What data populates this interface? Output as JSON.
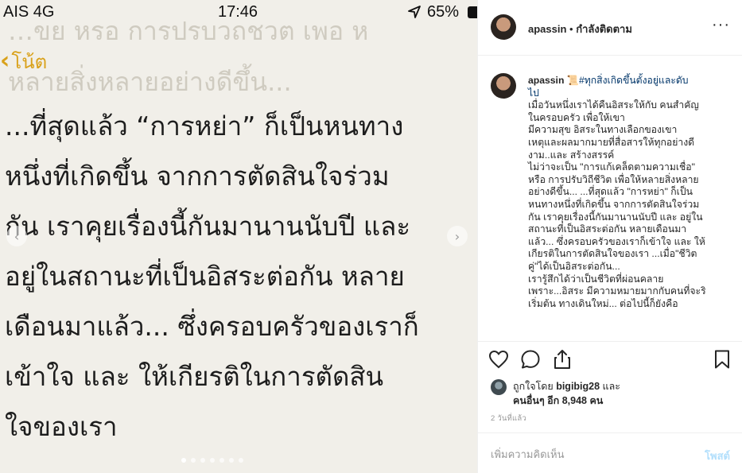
{
  "photo": {
    "status_bar": {
      "carrier": "AIS 4G",
      "time": "17:46",
      "battery": "65%"
    },
    "ghost_top": "…ขย  หรอ การปรบวถชวต เพอ ห",
    "back_label": "โน้ต",
    "ghost_mid": "หลายสิ่งหลายอย่างดีขึ้น...",
    "note_lines": [
      "...ที่สุดแล้ว “การหย่า” ก็เป็นหนทาง",
      "หนึ่งที่เกิดขึ้น จากการตัดสินใจร่วม",
      "กัน เราคุยเรื่องนี้กันมานานนับปี และ",
      "อยู่ในสถานะที่เป็นอิสระต่อกัน หลาย",
      "เดือนมาแล้ว... ซึ่งครอบครัวของเราก็",
      "เข้าใจ และ ให้เกียรติในการตัดสิน",
      "ใจของเรา"
    ]
  },
  "panel": {
    "header": {
      "username": "apassin",
      "separator": " • ",
      "follow_status": "กำลังติดตาม",
      "more": "···"
    },
    "caption": {
      "username": "apassin",
      "emoji": "📜",
      "hashtag": "#ทุกสิ่งเกิดขึ้นตั้งอยู่และดับ",
      "hashtag_cont": "ไป",
      "lines": [
        "เมื่อวันหนึ่งเราได้คืนอิสระให้กับ คนสำคัญ",
        "ในครอบครัว เพื่อให้เขา",
        "มีความสุข อิสระในทางเลือกของเขา",
        "เหตุและผลมากมายที่สื่อสารให้ทุกอย่างดี",
        "งาม..และ สร้างสรรค์",
        "ไม่ว่าจะเป็น \"การแก้เคล็ดตามความเชื่อ\"",
        "หรือ การปรับวิถีชีวิต เพื่อให้หลายสิ่งหลาย",
        "อย่างดีขึ้น... ...ที่สุดแล้ว \"การหย่า\" ก็เป็น",
        "หนทางหนึ่งที่เกิดขึ้น จากการตัดสินใจร่วม",
        "กัน เราคุยเรื่องนี้กันมานานนับปี และ อยู่ใน",
        "สถานะที่เป็นอิสระต่อกัน หลายเดือนมา",
        "แล้ว... ซึ่งครอบครัวของเราก็เข้าใจ และ ให้",
        "เกียรติในการตัดสินใจของเรา ...เมื่อ\"ชีวิต",
        "คู่\"ได้เป็นอิสระต่อกัน...",
        "เรารู้สึกได้ว่าเป็นชีวิตที่ผ่อนคลาย",
        "เพราะ...อิสระ มีความหมายมากกับคนที่จะริ",
        "เริ่มต้น ทางเดินใหม่... ต่อไปนี้ก็ยังคือ"
      ]
    },
    "likes": {
      "prefix": "ถูกใจโดย ",
      "first_liker": "bigibig28",
      "and": " และ",
      "others": "คนอื่นๆ อีก 8,948 คน"
    },
    "timestamp": "2 วันที่แล้ว",
    "comment": {
      "placeholder": "เพิ่มความคิดเห็น",
      "post_label": "โพสต์"
    }
  }
}
